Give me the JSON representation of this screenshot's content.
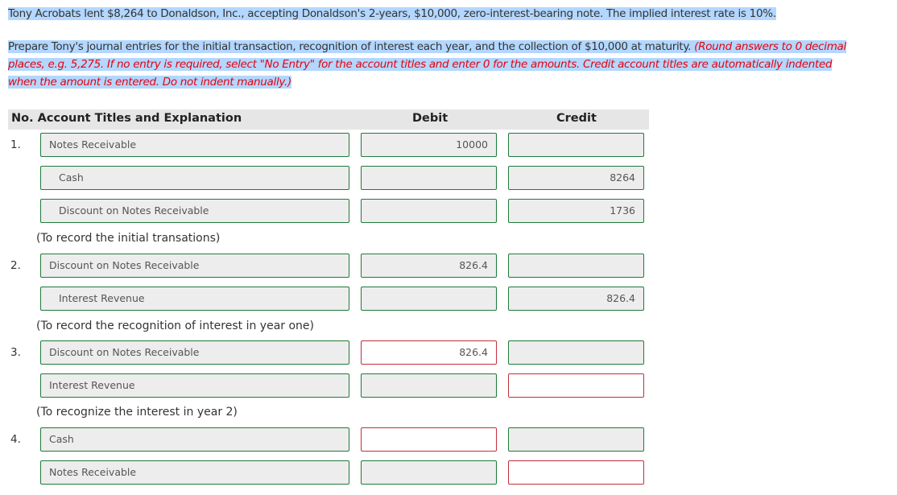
{
  "question": {
    "intro": "Tony Acrobats lent $8,264 to Donaldson, Inc., accepting Donaldson's 2-years, $10,000, zero-interest-bearing note. The implied interest rate is 10%.",
    "prompt": "Prepare Tony's journal entries for the initial transaction, recognition of interest each year, and the collection of $10,000 at maturity.",
    "instructions": "(Round answers to 0 decimal places, e.g. 5,275. If no entry is required, select \"No Entry\" for the account titles and enter 0 for the amounts. Credit account titles are automatically indented when the amount is entered. Do not indent manually.)"
  },
  "table": {
    "headers": {
      "no_account": "No. Account Titles and Explanation",
      "debit": "Debit",
      "credit": "Credit"
    },
    "entries": [
      {
        "no": "1.",
        "explanation": "(To record the initial transations)",
        "lines": [
          {
            "account": "Notes Receivable",
            "debit": "10000",
            "credit": ""
          },
          {
            "account": "Cash",
            "debit": "",
            "credit": "8264"
          },
          {
            "account": "Discount on Notes Receivable",
            "debit": "",
            "credit": "1736"
          }
        ]
      },
      {
        "no": "2.",
        "explanation": "(To record the recognition of interest in year one)",
        "lines": [
          {
            "account": "Discount on Notes Receivable",
            "debit": "826.4",
            "credit": ""
          },
          {
            "account": "Interest Revenue",
            "debit": "",
            "credit": "826.4"
          }
        ]
      },
      {
        "no": "3.",
        "explanation": "(To recognize the interest in year 2)",
        "lines": [
          {
            "account": "Discount on Notes Receivable",
            "debit": "826.4",
            "credit": ""
          },
          {
            "account": "Interest Revenue",
            "debit": "",
            "credit": ""
          }
        ]
      },
      {
        "no": "4.",
        "explanation": "",
        "lines": [
          {
            "account": "Cash",
            "debit": "",
            "credit": ""
          },
          {
            "account": "Notes Receivable",
            "debit": "",
            "credit": ""
          }
        ]
      }
    ]
  },
  "colors": {
    "correct_border": "#1e7b3a",
    "incorrect_border": "#c0303c",
    "selection": "#b3d7ff",
    "instruction_text": "#e8000b"
  }
}
